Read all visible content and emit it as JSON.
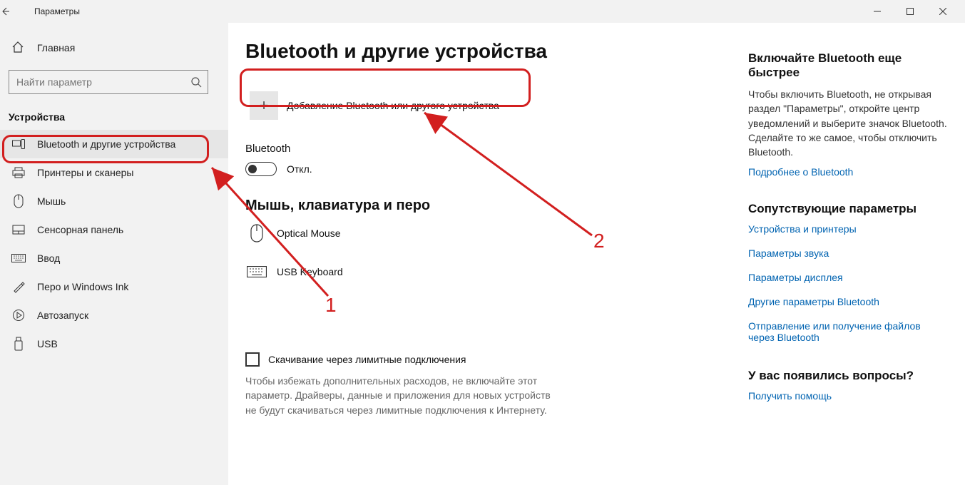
{
  "titlebar": {
    "title": "Параметры"
  },
  "sidebar": {
    "home": "Главная",
    "search_placeholder": "Найти параметр",
    "section": "Устройства",
    "items": [
      {
        "label": "Bluetooth и другие устройства"
      },
      {
        "label": "Принтеры и сканеры"
      },
      {
        "label": "Мышь"
      },
      {
        "label": "Сенсорная панель"
      },
      {
        "label": "Ввод"
      },
      {
        "label": "Перо и Windows Ink"
      },
      {
        "label": "Автозапуск"
      },
      {
        "label": "USB"
      }
    ]
  },
  "main": {
    "title": "Bluetooth и другие устройства",
    "add_label": "Добавление Bluetooth или другого устройства",
    "bt_label": "Bluetooth",
    "bt_state": "Откл.",
    "group_title": "Мышь, клавиатура и перо",
    "devices": [
      {
        "label": "Optical Mouse"
      },
      {
        "label": "USB Keyboard"
      }
    ],
    "check_label": "Скачивание через лимитные подключения",
    "check_desc": "Чтобы избежать дополнительных расходов, не включайте этот параметр. Драйверы, данные и приложения для новых устройств не будут скачиваться через лимитные подключения к Интернету."
  },
  "aside": {
    "h1": "Включайте Bluetooth еще быстрее",
    "p1": "Чтобы включить Bluetooth, не открывая раздел \"Параметры\", откройте центр уведомлений и выберите значок Bluetooth. Сделайте то же самое, чтобы отключить Bluetooth.",
    "link_more": "Подробнее о Bluetooth",
    "h2": "Сопутствующие параметры",
    "links": [
      "Устройства и принтеры",
      "Параметры звука",
      "Параметры дисплея",
      "Другие параметры Bluetooth",
      "Отправление или получение файлов через Bluetooth"
    ],
    "h3": "У вас появились вопросы?",
    "help_link": "Получить помощь"
  },
  "annotations": {
    "num1": "1",
    "num2": "2"
  }
}
